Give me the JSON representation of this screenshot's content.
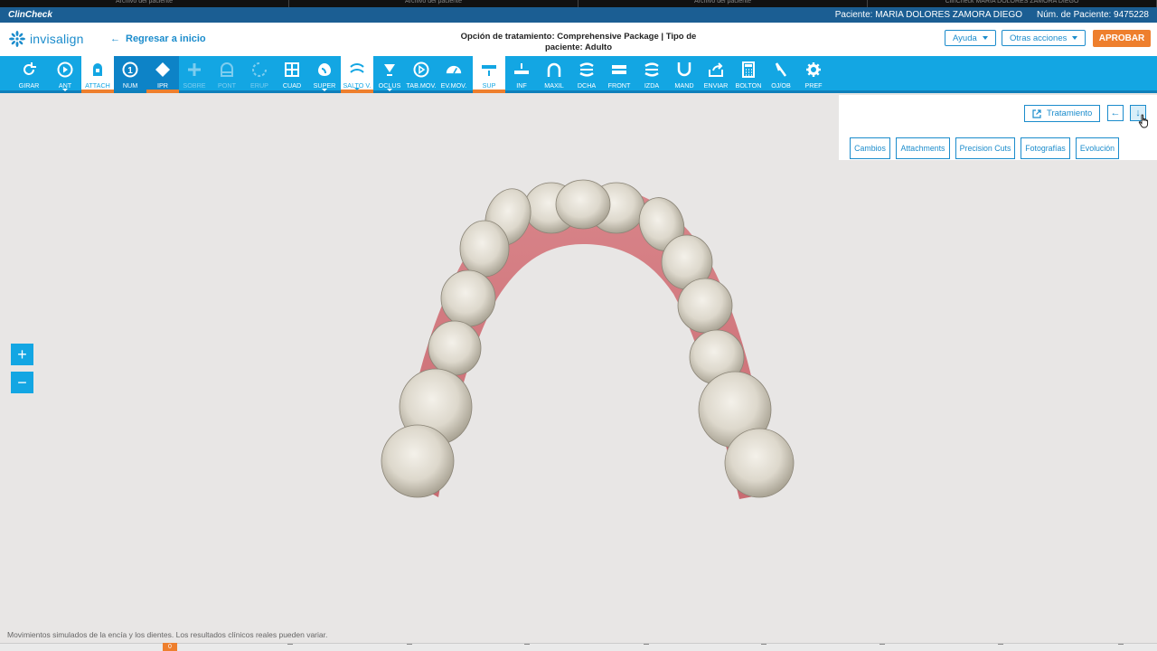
{
  "top_tabs": [
    "Archivo del paciente",
    "Archivo del paciente",
    "Archivo del paciente",
    "ClinCheck MARIA DOLORES ZAMORA DIEGO"
  ],
  "app_name": "ClinCheck",
  "patient": {
    "name_label": "Paciente: MARIA DOLORES ZAMORA DIEGO",
    "number_label": "Núm. de Paciente: 9475228"
  },
  "header": {
    "logo_text": "invisalign",
    "back_link": "Regresar a inicio",
    "treatment_line1": "Opción de tratamiento: Comprehensive Package | Tipo de",
    "treatment_line2": "paciente: Adulto",
    "help_label": "Ayuda",
    "more_actions_label": "Otras acciones",
    "approve_label": "APROBAR"
  },
  "toolbar": [
    {
      "id": "girar",
      "label": "GIRAR",
      "icon": "rotate-icon"
    },
    {
      "id": "ant",
      "label": "ANT",
      "icon": "play-back-icon",
      "dropdown": true
    },
    {
      "id": "attach",
      "label": "ATTACH",
      "icon": "attachment-icon",
      "state": "selected"
    },
    {
      "id": "num",
      "label": "NUM",
      "icon": "number-icon",
      "state": "active"
    },
    {
      "id": "ipr",
      "label": "IPR",
      "icon": "ipr-diamond-icon",
      "state": "active-orange"
    },
    {
      "id": "sobre",
      "label": "SOBRE",
      "icon": "plus-icon",
      "state": "disabled"
    },
    {
      "id": "pont",
      "label": "PONT",
      "icon": "pontic-icon",
      "state": "disabled"
    },
    {
      "id": "erup",
      "label": "ERUP",
      "icon": "eruption-icon",
      "state": "disabled"
    },
    {
      "id": "cuad",
      "label": "CUAD",
      "icon": "grid-icon"
    },
    {
      "id": "super",
      "label": "SUPER",
      "icon": "superimpose-icon",
      "dropdown": true
    },
    {
      "id": "salto",
      "label": "SALTO V.",
      "icon": "jump-icon",
      "state": "selected",
      "dropdown": true
    },
    {
      "id": "oclus",
      "label": "OCLUS",
      "icon": "occlusion-icon",
      "dropdown": true
    },
    {
      "id": "tabmov",
      "label": "TAB.MOV.",
      "icon": "movement-table-icon"
    },
    {
      "id": "evmov",
      "label": "EV.MOV.",
      "icon": "movement-eval-icon"
    },
    {
      "id": "sup",
      "label": "SUP",
      "icon": "upper-arch-icon",
      "state": "selected"
    },
    {
      "id": "inf",
      "label": "INF",
      "icon": "lower-arch-icon"
    },
    {
      "id": "maxil",
      "label": "MAXIL",
      "icon": "maxillary-icon"
    },
    {
      "id": "dcha",
      "label": "DCHA",
      "icon": "right-view-icon"
    },
    {
      "id": "front",
      "label": "FRONT",
      "icon": "front-view-icon"
    },
    {
      "id": "izda",
      "label": "IZDA",
      "icon": "left-view-icon"
    },
    {
      "id": "mand",
      "label": "MAND",
      "icon": "mandibular-icon"
    },
    {
      "id": "enviar",
      "label": "ENVIAR",
      "icon": "share-icon"
    },
    {
      "id": "bolton",
      "label": "BOLTON",
      "icon": "calculator-icon"
    },
    {
      "id": "ojob",
      "label": "OJ/OB",
      "icon": "overjet-icon"
    },
    {
      "id": "pref",
      "label": "PREF",
      "icon": "settings-gear-icon"
    }
  ],
  "side_panel": {
    "treatment_button": "Tratamiento",
    "tabs": [
      "Cambios",
      "Attachments",
      "Precision Cuts",
      "Fotografías",
      "Evolución"
    ]
  },
  "zoom": {
    "in": "+",
    "out": "−"
  },
  "disclaimer": "Movimientos simulados de la encía y los dientes. Los resultados clínicos reales pueden variar.",
  "timeline": {
    "current_stage": "0"
  },
  "colors": {
    "accent": "#13a6e3",
    "brand_bar": "#1b5e93",
    "approve": "#ee7f2d"
  }
}
